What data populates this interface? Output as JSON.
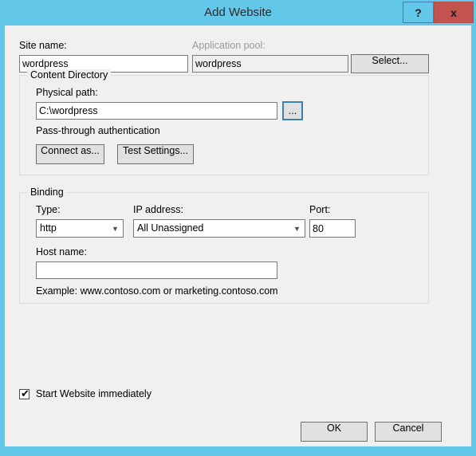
{
  "window": {
    "title": "Add Website",
    "frame_color": "#63c7ea",
    "body_color": "#f0f0f0",
    "close_color": "#c2534f"
  },
  "caption": {
    "help_label": "?",
    "close_label": "x"
  },
  "site": {
    "name_label": "Site name:",
    "name_value": "wordpress",
    "pool_label": "Application pool:",
    "pool_value": "wordpress",
    "select_button": "Select..."
  },
  "content_directory": {
    "group_title": "Content Directory",
    "physical_path_label": "Physical path:",
    "physical_path_value": "C:\\wordpress",
    "browse_button": "...",
    "auth_text": "Pass-through authentication",
    "connect_as_button": "Connect as...",
    "test_settings_button": "Test Settings..."
  },
  "binding": {
    "group_title": "Binding",
    "type_label": "Type:",
    "type_value": "http",
    "ip_label": "IP address:",
    "ip_value": "All Unassigned",
    "port_label": "Port:",
    "port_value": "80",
    "host_label": "Host name:",
    "host_value": "",
    "example_text": "Example: www.contoso.com or marketing.contoso.com"
  },
  "footer": {
    "start_checkbox_label": "Start Website immediately",
    "start_checkbox_checked": true,
    "checkmark_glyph": "✔",
    "ok_button": "OK",
    "cancel_button": "Cancel"
  }
}
